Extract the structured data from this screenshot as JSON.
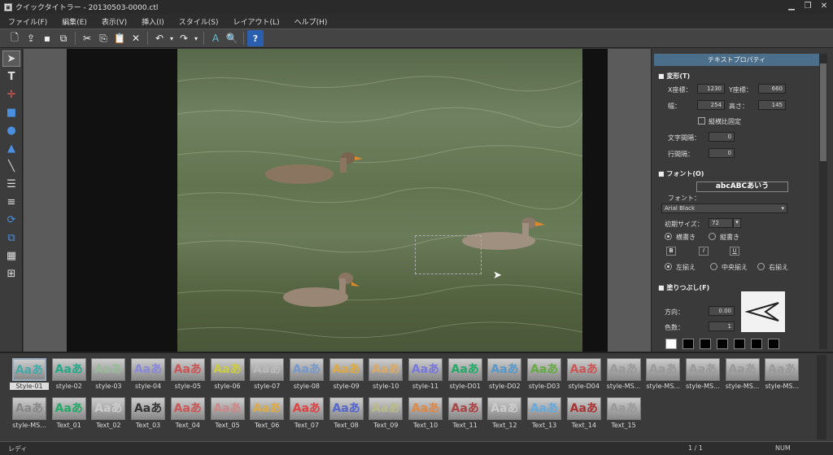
{
  "window": {
    "title": "クイックタイトラー - 20130503-0000.ctl"
  },
  "menu": [
    "ファイル(F)",
    "編集(E)",
    "表示(V)",
    "挿入(I)",
    "スタイル(S)",
    "レイアウト(L)",
    "ヘルプ(H)"
  ],
  "toolbar": {
    "icons": [
      "new-icon",
      "open-icon",
      "save-icon",
      "save-as-icon",
      "cut-icon",
      "copy-icon",
      "paste-icon",
      "delete-icon",
      "undo-icon",
      "redo-icon",
      "text-effect-icon",
      "text-search-icon",
      "help-icon"
    ]
  },
  "lefttools": [
    "select-arrow-icon",
    "text-tool-icon",
    "transform-icon",
    "rectangle-icon",
    "ellipse-icon",
    "triangle-icon",
    "line-icon",
    "align-icon",
    "distribute-icon",
    "rotate-icon",
    "order-icon",
    "grid-icon",
    "table-icon"
  ],
  "panel": {
    "title": "テキストプロパティ",
    "transform": {
      "header": "変形(T)",
      "x_label": "X座標：",
      "x_value": "1230",
      "y_label": "Y座標：",
      "y_value": "660",
      "w_label": "幅：",
      "w_value": "254",
      "h_label": "高さ：",
      "h_value": "145",
      "aspect_label": "縦横比固定",
      "char_spacing_label": "文字間隔：",
      "char_spacing_value": "0",
      "line_spacing_label": "行間隔：",
      "line_spacing_value": "0"
    },
    "font": {
      "header": "フォント(O)",
      "preview": "abcABCあいう",
      "font_label": "フォント：",
      "font_value": "Arial Black",
      "size_label": "初期サイズ：",
      "size_value": "72",
      "horizontal": "横書き",
      "vertical": "縦書き",
      "bold": "B",
      "italic": "I",
      "underline": "U",
      "align_left": "左揃え",
      "align_center": "中央揃え",
      "align_right": "右揃え"
    },
    "fill": {
      "header": "塗りつぶし(F)",
      "direction_label": "方向：",
      "direction_value": "0.00",
      "colors_label": "色数：",
      "colors_value": "1"
    }
  },
  "styles_row1": [
    "Style-01",
    "style-02",
    "style-03",
    "style-04",
    "style-05",
    "style-06",
    "style-07",
    "style-08",
    "style-09",
    "style-10",
    "style-11",
    "style-D01",
    "style-D02",
    "style-D03",
    "style-D04",
    "style-MS...",
    "style-MS...",
    "style-MS...",
    "style-MS...",
    "style-MS..."
  ],
  "styles_row2": [
    "style-MS...",
    "Text_01",
    "Text_02",
    "Text_03",
    "Text_04",
    "Text_05",
    "Text_06",
    "Text_07",
    "Text_08",
    "Text_09",
    "Text_10",
    "Text_11",
    "Text_12",
    "Text_13",
    "Text_14",
    "Text_15"
  ],
  "swatch_text": "Aaあ",
  "status": {
    "left": "レディ",
    "page": "1 / 1",
    "num": "NUM"
  }
}
